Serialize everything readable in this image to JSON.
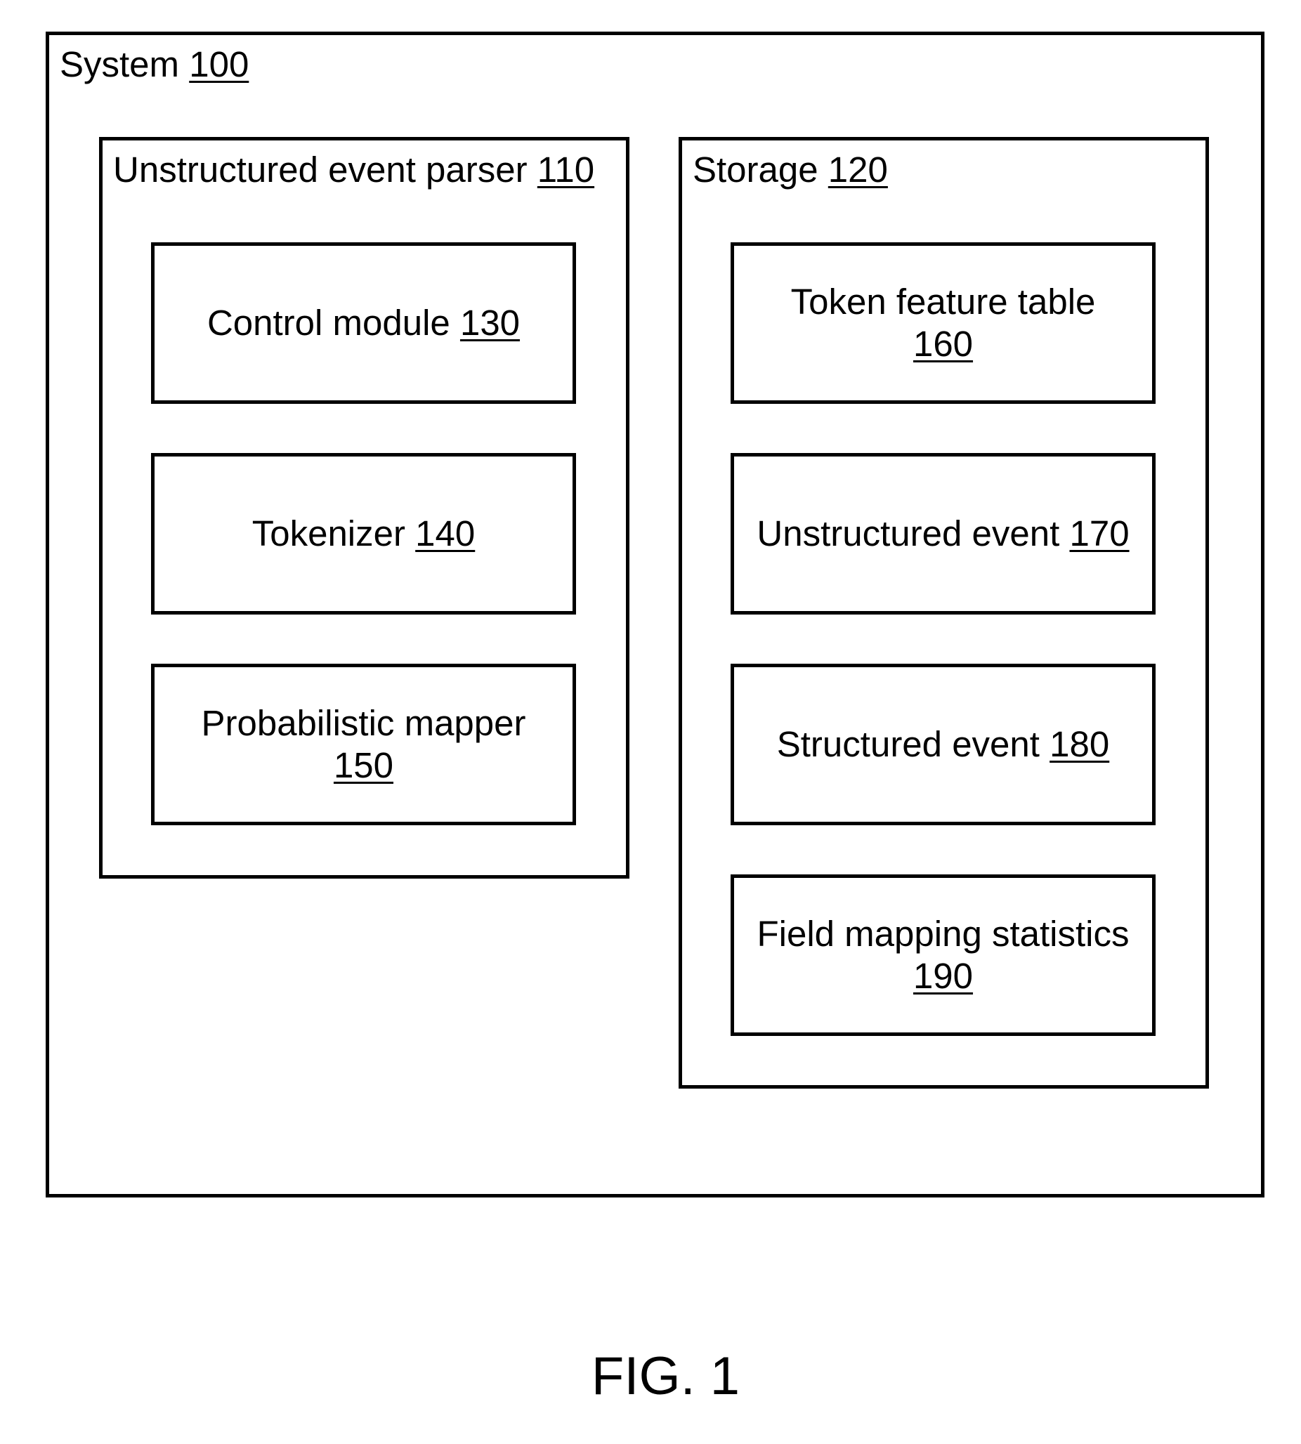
{
  "system": {
    "label": "System",
    "ref": "100"
  },
  "parser": {
    "label": "Unstructured event parser",
    "ref": "110",
    "components": [
      {
        "label": "Control module",
        "ref": "130",
        "ref_on_new_line": false
      },
      {
        "label": "Tokenizer",
        "ref": "140",
        "ref_on_new_line": false
      },
      {
        "label": "Probabilistic mapper",
        "ref": "150",
        "ref_on_new_line": true
      }
    ]
  },
  "storage": {
    "label": "Storage",
    "ref": "120",
    "components": [
      {
        "label": "Token feature table",
        "ref": "160",
        "ref_on_new_line": true
      },
      {
        "label": "Unstructured event",
        "ref": "170",
        "ref_on_new_line": false
      },
      {
        "label": "Structured event",
        "ref": "180",
        "ref_on_new_line": false
      },
      {
        "label": "Field mapping statistics",
        "ref": "190",
        "ref_on_new_line": true
      }
    ]
  },
  "figure": {
    "caption": "FIG. 1"
  },
  "colors": {
    "stroke": "#000000",
    "background": "#ffffff",
    "text": "#000000"
  }
}
